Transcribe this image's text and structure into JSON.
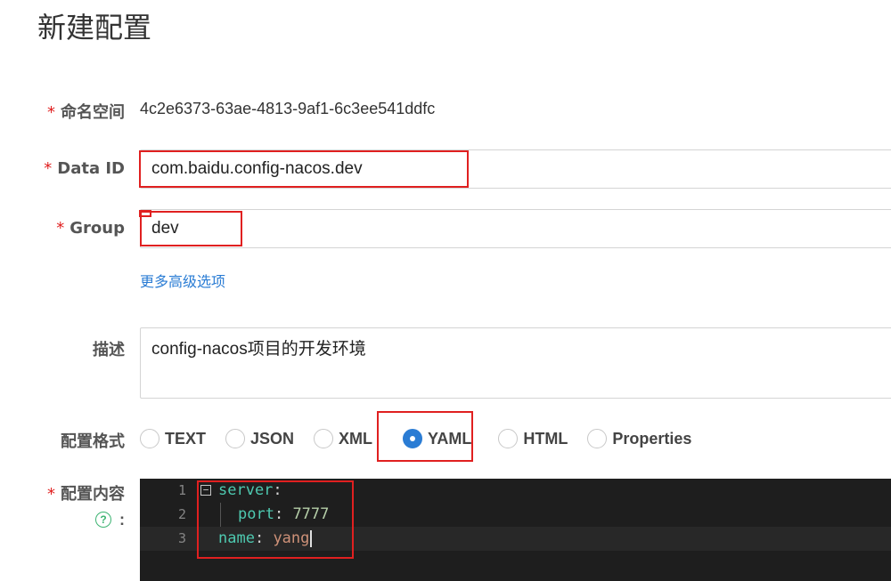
{
  "page": {
    "title": "新建配置"
  },
  "form": {
    "namespace": {
      "label": "命名空间",
      "value": "4c2e6373-63ae-4813-9af1-6c3ee541ddfc"
    },
    "data_id": {
      "label": "Data ID",
      "value": "com.baidu.config-nacos.dev"
    },
    "group": {
      "label": "Group",
      "value": "dev"
    },
    "advanced_link": "更多高级选项",
    "description": {
      "label": "描述",
      "value": "config-nacos项目的开发环境"
    },
    "format": {
      "label": "配置格式",
      "options": [
        "TEXT",
        "JSON",
        "XML",
        "YAML",
        "HTML",
        "Properties"
      ],
      "selected": "YAML"
    },
    "content": {
      "label": "配置内容",
      "help_icon": "?",
      "colon": ":",
      "lines": [
        {
          "num": "1",
          "key": "server",
          "value": ""
        },
        {
          "num": "2",
          "key": "port",
          "value": "7777"
        },
        {
          "num": "3",
          "key": "name",
          "value": "yang"
        }
      ]
    }
  },
  "colors": {
    "required": "#e02020",
    "link": "#2a7cd4",
    "radio_checked": "#2a7cd4",
    "highlight": "#e02020",
    "editor_bg": "#1e1e1e"
  }
}
